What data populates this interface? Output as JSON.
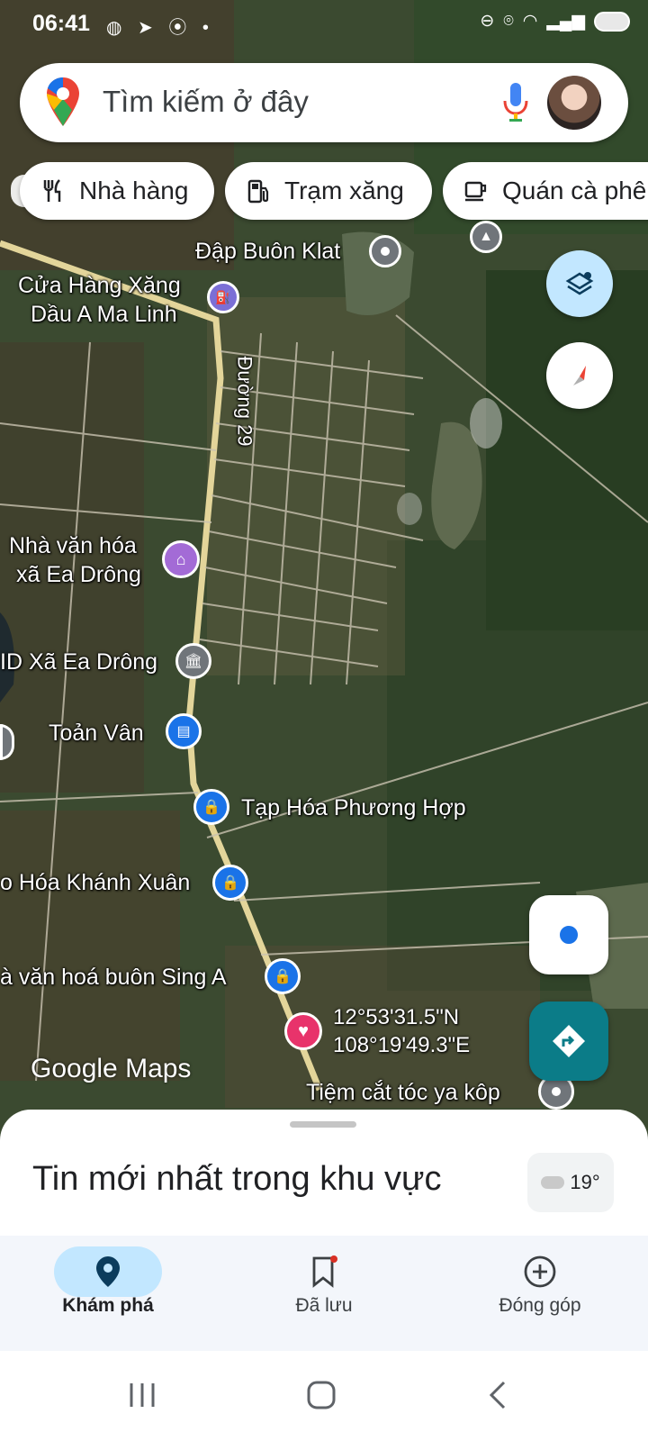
{
  "status_bar": {
    "time": "06:41",
    "left_icons": "messenger-icon send-icon hotspot-icon dot",
    "right_icons": "dnd-icon location-icon wifi-icon signal-icon battery-icon"
  },
  "search": {
    "placeholder": "Tìm kiếm ở đây",
    "icons": [
      "google-maps-pin-icon",
      "mic-icon",
      "avatar"
    ]
  },
  "chips": [
    {
      "label": "Nhà hàng",
      "icon": "restaurant-icon"
    },
    {
      "label": "Trạm xăng",
      "icon": "gas-station-icon"
    },
    {
      "label": "Quán cà phê",
      "icon": "coffee-icon"
    }
  ],
  "map": {
    "places": [
      {
        "name": "Đập Buôn Klat",
        "type": "landmark"
      },
      {
        "name": "Cửa Hàng Xăng Dầu A Ma Linh",
        "lines": [
          "Cửa Hàng Xăng",
          "Dầu A Ma Linh"
        ],
        "type": "gas"
      },
      {
        "name": "Đường 29",
        "type": "road"
      },
      {
        "name": "Nhà văn hóa xã Ea Drông",
        "lines": [
          "Nhà văn hóa",
          "xã Ea Drông"
        ],
        "type": "culture"
      },
      {
        "name": "ID Xã Ea Drông",
        "type": "government"
      },
      {
        "name": "Toản Vân",
        "type": "store"
      },
      {
        "name": "Tạp Hóa Phương Hợp",
        "type": "shopping"
      },
      {
        "name": "o Hóa Khánh Xuân",
        "type": "shopping"
      },
      {
        "name": "à văn hoá buôn Sing A",
        "type": "shopping"
      },
      {
        "name": "Tiệm cắt tóc ya kôp",
        "type": "service"
      }
    ],
    "dropped_pin": {
      "lat": "12°53'31.5\"N",
      "lng": "108°19'49.3\"E"
    },
    "logo": "Google Maps"
  },
  "fabs": {
    "layers": "layers-icon",
    "compass": "compass-icon",
    "my_location": "my-location-icon",
    "directions": "directions-icon"
  },
  "sheet": {
    "title": "Tin mới nhất trong khu vực",
    "weather": "19°"
  },
  "bottom_nav": [
    {
      "label": "Khám phá",
      "icon": "explore-pin-icon",
      "active": true
    },
    {
      "label": "Đã lưu",
      "icon": "bookmark-icon",
      "badge": true
    },
    {
      "label": "Đóng góp",
      "icon": "add-circle-icon"
    }
  ],
  "colors": {
    "accent": "#1a73e8",
    "nav_active_bg": "#c2e7ff",
    "directions": "#0b7c88",
    "heart": "#e8336b"
  }
}
